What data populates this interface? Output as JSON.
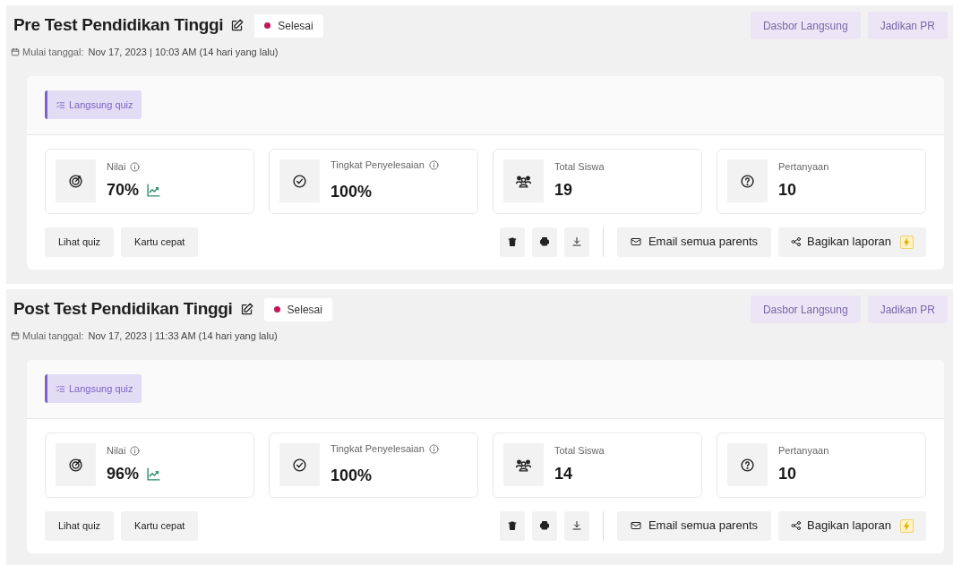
{
  "quizzes": [
    {
      "title": "Pre Test Pendidikan Tinggi",
      "status": "Selesai",
      "header_buttons": [
        "Dasbor Langsung",
        "Jadikan PR"
      ],
      "date_label": "Mulai tanggal:",
      "date": "Nov 17, 2023 | 10:03 AM (14 hari yang lalu)",
      "tabs": [
        {
          "label": "Langsung quiz",
          "selected": true
        }
      ],
      "stats": [
        {
          "kind": "score",
          "label": "Nilai",
          "info": true,
          "value": "70%",
          "trend": true
        },
        {
          "kind": "completion",
          "label": "Tingkat Penyelesaian",
          "info": true,
          "value": "100%",
          "trend": false
        },
        {
          "kind": "students",
          "label": "Total Siswa",
          "info": false,
          "value": "19",
          "trend": false
        },
        {
          "kind": "questions",
          "label": "Pertanyaan",
          "info": false,
          "value": "10",
          "trend": false
        }
      ],
      "left_buttons": [
        "Lihat quiz",
        "Kartu cepat"
      ],
      "email_button": "Email semua parents",
      "share_button": "Bagikan laporan"
    },
    {
      "title": "Post Test Pendidikan Tinggi",
      "status": "Selesai",
      "header_buttons": [
        "Dasbor Langsung",
        "Jadikan PR"
      ],
      "date_label": "Mulai tanggal:",
      "date": "Nov 17, 2023 | 11:33 AM (14 hari yang lalu)",
      "tabs": [
        {
          "label": "Langsung quiz",
          "selected": true
        }
      ],
      "stats": [
        {
          "kind": "score",
          "label": "Nilai",
          "info": true,
          "value": "96%",
          "trend": true
        },
        {
          "kind": "completion",
          "label": "Tingkat Penyelesaian",
          "info": true,
          "value": "100%",
          "trend": false
        },
        {
          "kind": "students",
          "label": "Total Siswa",
          "info": false,
          "value": "14",
          "trend": false
        },
        {
          "kind": "questions",
          "label": "Pertanyaan",
          "info": false,
          "value": "10",
          "trend": false
        }
      ],
      "left_buttons": [
        "Lihat quiz",
        "Kartu cepat"
      ],
      "email_button": "Email semua parents",
      "share_button": "Bagikan laporan"
    }
  ]
}
